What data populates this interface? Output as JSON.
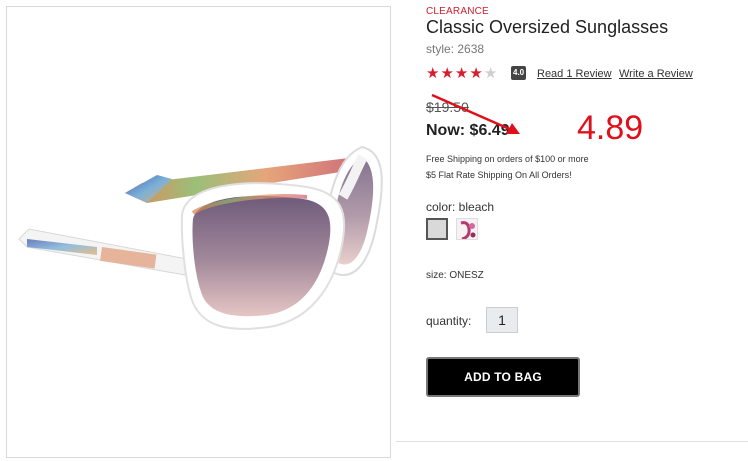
{
  "product": {
    "badge": "CLEARANCE",
    "title": "Classic Oversized Sunglasses",
    "style": "style: 2638",
    "rating": {
      "stars_filled": 4,
      "stars_total": 5,
      "score": "4.0",
      "read_review": "Read 1 Review",
      "write_review": "Write a Review"
    },
    "price": {
      "old": "$19.50",
      "now": "Now: $6.49"
    },
    "shipping": [
      "Free Shipping on orders of $100 or more",
      "$5 Flat Rate Shipping On All Orders!"
    ],
    "color_label": "color: bleach",
    "size_label": "size: ONESZ",
    "quantity_label": "quantity:",
    "quantity_value": "1",
    "add_to_bag": "ADD TO BAG"
  },
  "annotation": {
    "value": "4.89",
    "color": "#e0101a"
  },
  "colors": {
    "accent_red": "#d6202f",
    "button_black": "#000000"
  }
}
